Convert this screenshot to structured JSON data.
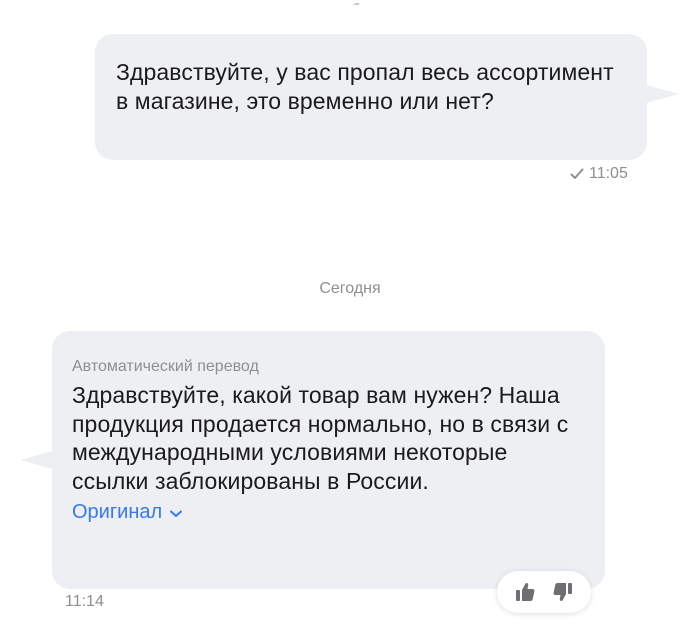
{
  "outgoing_message": {
    "text": "Здравствуйте, у вас пропал весь ассортимент в магазине, это временно или нет?",
    "time": "11:05",
    "status_icon": "check-icon"
  },
  "date_separator": "Сегодня",
  "incoming_message": {
    "translation_label": "Автоматический перевод",
    "text": "Здравствуйте, какой товар вам нужен? Наша продукция продается нормально, но в связи с международными условиями некоторые ссылки заблокированы в России.",
    "original_link": "Оригинал",
    "time": "11:14"
  },
  "feedback": {
    "like_icon": "thumbs-up-icon",
    "dislike_icon": "thumbs-down-icon"
  },
  "colors": {
    "bubble": "#eeeff3",
    "link": "#3478f6",
    "muted": "#8e8e93",
    "text": "#1b1b1b"
  }
}
